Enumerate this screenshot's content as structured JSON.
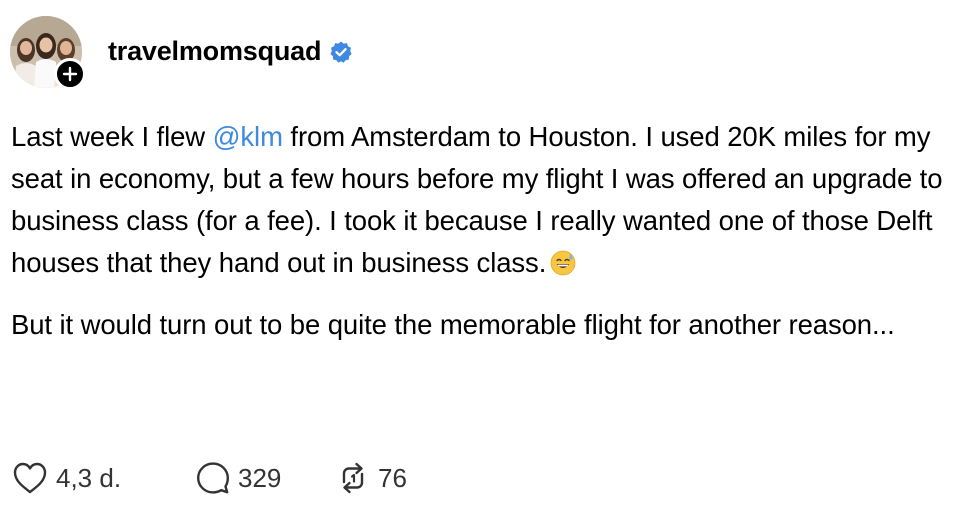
{
  "post": {
    "author": {
      "username": "travelmomsquad",
      "verified": true,
      "avatar_icon": "avatar-photo-icon",
      "follow_icon": "plus-icon"
    },
    "body": {
      "p1_part1": "Last week I flew ",
      "mention": "@klm",
      "p1_part2": " from Amsterdam to Houston. I used 20K miles for my seat in economy, but a few hours before my flight I was offered an upgrade to business class (for a fee). I took it because I really wanted one of those Delft houses that they hand out in business class.",
      "emoji": "grinning-face-with-sweat-emoji",
      "p2": "But it would turn out to be quite the memorable flight for another reason..."
    },
    "actions": {
      "likes": "4,3 d.",
      "replies": "329",
      "reposts": "76"
    },
    "colors": {
      "mention": "#3f8ae0",
      "verified": "#3f8ae0",
      "text": "#000000",
      "action_text": "#333333"
    }
  }
}
